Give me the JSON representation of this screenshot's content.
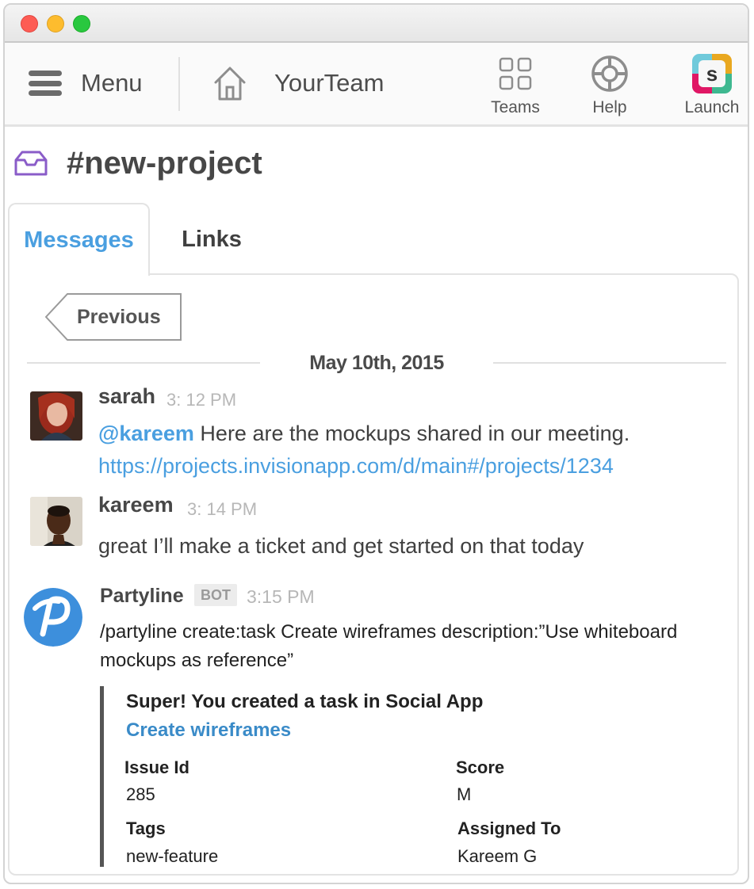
{
  "topbar": {
    "menu_label": "Menu",
    "team_name": "YourTeam",
    "actions": [
      {
        "label": "Teams",
        "icon": "grid-icon"
      },
      {
        "label": "Help",
        "icon": "lifebuoy-icon"
      },
      {
        "label": "Launch",
        "icon": "slack-logo-icon"
      }
    ],
    "launch_logo_letter": "s"
  },
  "channel": {
    "name": "#new-project",
    "icon": "inbox-icon",
    "accent_color": "#8a5cc8"
  },
  "tabs": [
    {
      "label": "Messages",
      "active": true
    },
    {
      "label": "Links",
      "active": false
    }
  ],
  "pagination": {
    "previous_label": "Previous"
  },
  "date_divider": "May 10th, 2015",
  "messages": [
    {
      "author": "sarah",
      "time": "3: 12 PM",
      "mention": "@kareem",
      "text": " Here are the mockups  shared in our meeting.",
      "link": "https://projects.invisionapp.com/d/main#/projects/1234"
    },
    {
      "author": "kareem",
      "time": "3: 14 PM",
      "text": "great I’ll make a ticket and get started on that today"
    },
    {
      "author": "Partyline",
      "badge": "BOT",
      "time": "3:15 PM",
      "text": "/partyline create:task Create wireframes description:”Use whiteboard mockups as reference”",
      "attachment": {
        "title": "Super! You created a task in Social App",
        "link_text": "Create wireframes",
        "fields": [
          {
            "label": "Issue Id",
            "value": "285"
          },
          {
            "label": "Score",
            "value": "M"
          },
          {
            "label": "Tags",
            "value": "new-feature"
          },
          {
            "label": "Assigned To",
            "value": "Kareem G"
          }
        ]
      }
    }
  ],
  "colors": {
    "link": "#4a9fe0",
    "attachment_link": "#3a8bc8",
    "bot_brand": "#3d8fdc"
  }
}
